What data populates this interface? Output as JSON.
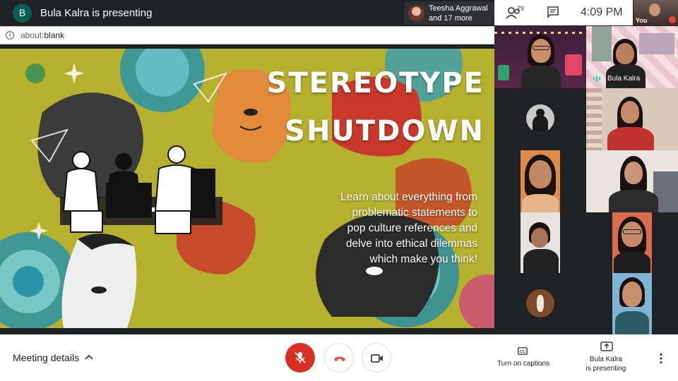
{
  "topbar": {
    "presenter_initial": "B",
    "presenting_title": "Bula Kalra is presenting",
    "people_chip": {
      "line1": "Teesha Aggrawal",
      "line2": "and 17 more"
    },
    "participant_count": "29",
    "clock": "4:09 PM",
    "self_label": "You"
  },
  "browser": {
    "url_scheme": "about:",
    "url_path": "blank"
  },
  "slide": {
    "title_line1": "STEREOTYPE",
    "title_line2": "SHUTDOWN",
    "body_lines": [
      "Learn about everything from",
      "problematic statements to",
      "pop culture references and",
      "delve into ethical dilemmas",
      "which make you think!"
    ]
  },
  "participants": {
    "speaking_name": "Bula Kalra"
  },
  "bottombar": {
    "meeting_details": "Meeting details",
    "captions_label": "Turn on captions",
    "present_line1": "Bula Kalra",
    "present_line2": "is presenting"
  },
  "colors": {
    "mic_off_red": "#d93025",
    "end_call_red": "#ea4335",
    "presenter_avatar": "#0b5e52",
    "slide_olive": "#b6b230"
  }
}
